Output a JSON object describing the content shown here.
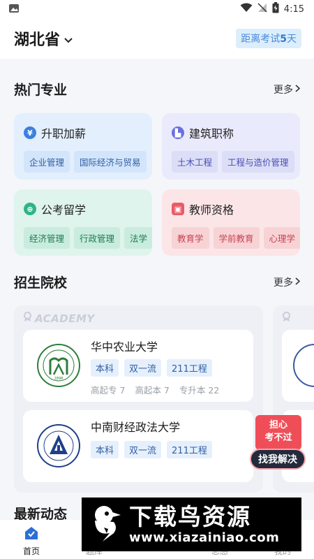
{
  "status_bar": {
    "time": "4:15"
  },
  "header": {
    "province": "湖北省",
    "countdown_prefix": "距离考试",
    "countdown_days": "5",
    "countdown_suffix": "天"
  },
  "hot_majors": {
    "title": "热门专业",
    "more_label": "更多",
    "cards": [
      {
        "title": "升职加薪",
        "icon_glyph": "¥",
        "icon": "yen-icon",
        "tags": [
          "企业管理",
          "国际经济与贸易"
        ]
      },
      {
        "title": "建筑职称",
        "icon_glyph": "▙",
        "icon": "building-icon",
        "tags": [
          "土木工程",
          "工程与造价管理"
        ]
      },
      {
        "title": "公考留学",
        "icon_glyph": "⊕",
        "icon": "globe-icon",
        "tags": [
          "经济管理",
          "行政管理",
          "法学"
        ]
      },
      {
        "title": "教师资格",
        "icon_glyph": "▣",
        "icon": "book-icon",
        "tags": [
          "教育学",
          "学前教育",
          "心理学"
        ]
      }
    ],
    "colors": {
      "blue_bg": "#e3effd",
      "blue_tag": "#d3e5fb",
      "blue_icon": "#3b7fe0",
      "purple_bg": "#e9eafb",
      "purple_tag": "#dcdef7",
      "purple_icon": "#6a6fe0",
      "green_bg": "#dff4ec",
      "green_tag": "#c9ecde",
      "green_icon": "#2eb487",
      "red_bg": "#fbe5e7",
      "red_tag": "#f7d3d6",
      "red_icon": "#ec5a66"
    }
  },
  "schools": {
    "title": "招生院校",
    "more_label": "更多",
    "academy_label": "ACADEMY",
    "list": [
      {
        "name": "华中农业大学",
        "tags": [
          "本科",
          "双一流",
          "211工程"
        ],
        "stats": [
          "高起专 7",
          "高起本 7",
          "专升本 22"
        ],
        "logo_year": "1898",
        "logo_color": "#2e7d3a"
      },
      {
        "name": "中南财经政法大学",
        "tags": [
          "本科",
          "双一流",
          "211工程"
        ],
        "logo_color": "#1f3f8a"
      }
    ]
  },
  "help_badge": {
    "line1": "担心",
    "line2": "考不过",
    "button": "找我解决"
  },
  "latest_news": {
    "title": "最新动态"
  },
  "tabbar": {
    "tabs": [
      "首页",
      "题库",
      "",
      "总感",
      "我的"
    ]
  },
  "watermark": {
    "text": "下载鸟资源",
    "url": "www.xiazainiao.com"
  }
}
